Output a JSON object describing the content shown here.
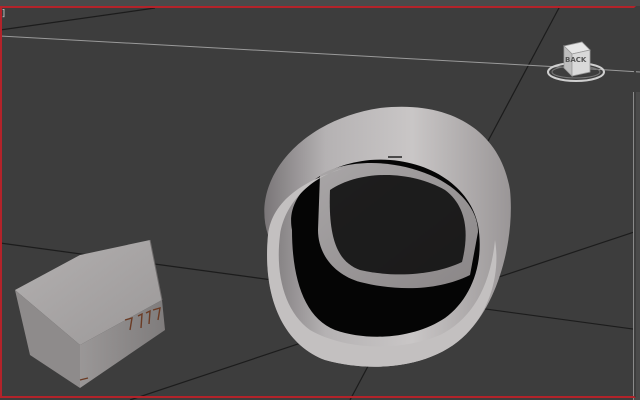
{
  "viewport": {
    "corner_label": "]",
    "viewcube_face": "BACK",
    "active_border_color": "#b3232a",
    "background_color": "#3d3d3d",
    "grid_color": "#1a1a1a"
  },
  "objects": [
    {
      "name": "cylinder-ring",
      "type": "tube"
    },
    {
      "name": "box-wedge",
      "type": "box"
    }
  ],
  "icons": {
    "viewcube": "viewcube-icon"
  }
}
